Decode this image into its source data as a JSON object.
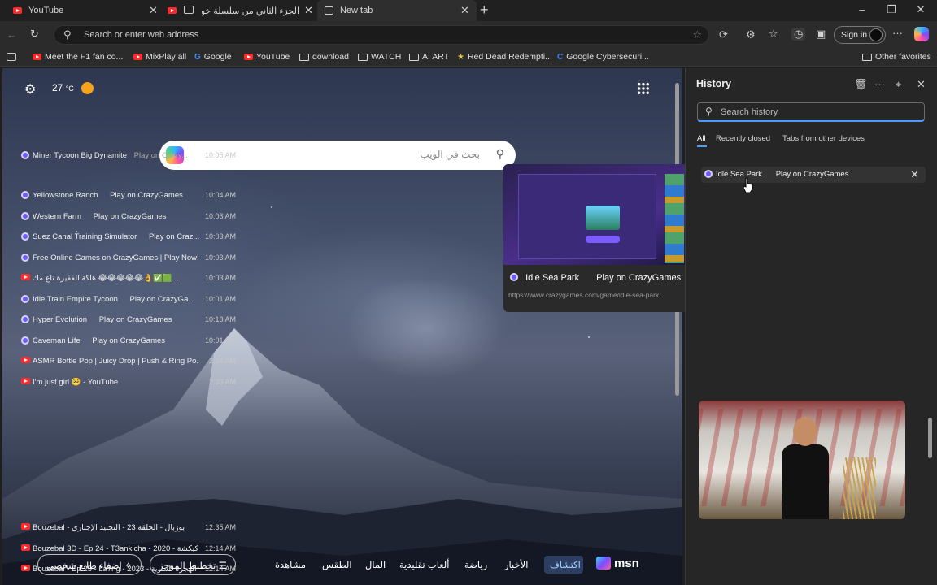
{
  "tabs": [
    {
      "label": "YouTube",
      "icon": "youtube-icon"
    },
    {
      "label": "الجزء الثاني من سلسلة خو خو",
      "icon": "youtube-icon"
    },
    {
      "label": "New tab",
      "icon": "new-tab-icon"
    }
  ],
  "toolbar": {
    "address_placeholder": "Search or enter web address",
    "sign_in": "Sign in"
  },
  "bookmarks": [
    {
      "label": "Meet the F1 fan co...",
      "icon": "youtube-icon"
    },
    {
      "label": "MixPlay all",
      "icon": "youtube-icon"
    },
    {
      "label": "Google",
      "icon": "google-icon"
    },
    {
      "label": "YouTube",
      "icon": "youtube-icon"
    },
    {
      "label": "download",
      "icon": "folder-icon"
    },
    {
      "label": "WATCH",
      "icon": "folder-icon"
    },
    {
      "label": "AI ART",
      "icon": "folder-icon"
    },
    {
      "label": "Red Dead Redempti...",
      "icon": "rdr-icon"
    },
    {
      "label": "Google Cybersecuri...",
      "icon": "chrome-icon"
    }
  ],
  "other_favorites": "Other favorites",
  "ntp": {
    "temperature": "27",
    "temp_unit": "°C",
    "search_placeholder": "بحث في الويب",
    "personalize": "إضفاء طابع شخصي",
    "feed_layout": "تخطيط الموجز",
    "feed_tabs": [
      "مشاهدة",
      "الطقس",
      "المال",
      "ألعاب تقليدية",
      "رياضة",
      "الأخبار"
    ],
    "explore": "اكتشاف",
    "brand": "msn"
  },
  "preview": {
    "title": "Idle Sea Park",
    "site": "Play on CrazyGames",
    "url": "https://www.crazygames.com/game/idle-sea-park"
  },
  "history": {
    "title": "History",
    "search_placeholder": "Search history",
    "tabs": [
      "All",
      "Recently closed",
      "Tabs from other devices"
    ],
    "items": [
      {
        "title": "Miner Tycoon Big Dynamite",
        "site": "Play on Crazy...",
        "time": "10:05 AM",
        "icon": "crazygames-icon"
      },
      {
        "title": "Idle Sea Park",
        "site": "Play on CrazyGames",
        "time": "",
        "icon": "crazygames-icon"
      },
      {
        "title": "Yellowstone Ranch",
        "site": "Play on CrazyGames",
        "time": "10:04 AM",
        "icon": "crazygames-icon"
      },
      {
        "title": "Western Farm",
        "site": "Play on CrazyGames",
        "time": "10:03 AM",
        "icon": "crazygames-icon"
      },
      {
        "title": "Suez Canal Training Simulator",
        "site": "Play on Craz...",
        "time": "10:03 AM",
        "icon": "crazygames-icon"
      },
      {
        "title": "Free Online Games on CrazyGames | Play Now!",
        "site": "",
        "time": "10:03 AM",
        "icon": "crazygames-icon"
      },
      {
        "title": "هاكة الفقيرة تاع مك 😂😂😂😂😂👌✅🟩...",
        "site": "",
        "time": "10:03 AM",
        "icon": "youtube-icon"
      },
      {
        "title": "Idle Train Empire Tycoon",
        "site": "Play on CrazyGa...",
        "time": "10:01 AM",
        "icon": "crazygames-icon"
      },
      {
        "title": "Hyper Evolution",
        "site": "Play on CrazyGames",
        "time": "10:18 AM",
        "icon": "crazygames-icon"
      },
      {
        "title": "Caveman Life",
        "site": "Play on CrazyGames",
        "time": "10:01 AM",
        "icon": "crazygames-icon"
      },
      {
        "title": "ASMR Bottle Pop | Juicy Drop | Push & Ring Po...",
        "site": "",
        "time": "2:34 AM",
        "icon": "youtube-icon"
      },
      {
        "title": "I'm just girl 🥺 - YouTube",
        "site": "",
        "time": "2:33 AM",
        "icon": "youtube-icon"
      },
      {
        "title": "بوزبال - الحلقة 23 - التجنيد الإجباري - Bouzebal",
        "site": "",
        "time": "12:35 AM",
        "icon": "youtube-icon"
      },
      {
        "title": "Bouzebal 3D - Ep 24 - T3ankicha - 2020 - كيكشة",
        "site": "",
        "time": "12:14 AM",
        "icon": "youtube-icon"
      },
      {
        "title": "Bouzebal - Ep 25 - La7rig - 2023 - الهجرة السرية",
        "site": "",
        "time": "12:14 AM",
        "icon": "youtube-icon"
      }
    ]
  },
  "colors": {
    "accent": "#4c9bff",
    "youtube": "#ff2b2b",
    "crazygames": "#6c5cff"
  }
}
